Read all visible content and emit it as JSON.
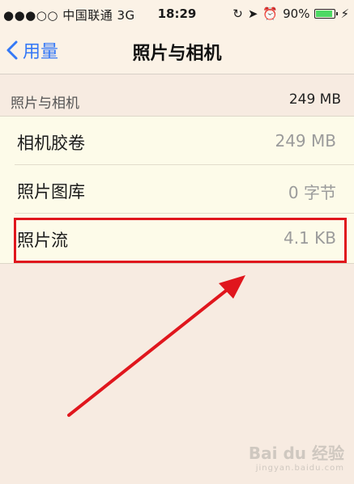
{
  "status_bar": {
    "carrier": "●●●○○ 中国联通  3G",
    "time": "18:29",
    "battery": "90%",
    "battery_level": 0.9,
    "battery_color": "#4cd964"
  },
  "nav": {
    "back_label": "用量",
    "title": "照片与相机"
  },
  "section": {
    "label": "照片与相机",
    "total": "249 MB"
  },
  "rows": [
    {
      "name": "相机胶卷",
      "size": "249 MB"
    },
    {
      "name": "照片图库",
      "size": "0 字节"
    },
    {
      "name": "照片流",
      "size": "4.1 KB"
    }
  ],
  "colors": {
    "accent": "#3478f6",
    "annotation": "#e0161d",
    "background": "#f7ebe1"
  },
  "watermark": {
    "brand": "Bai du 经验",
    "url": "jingyan.baidu.com"
  }
}
